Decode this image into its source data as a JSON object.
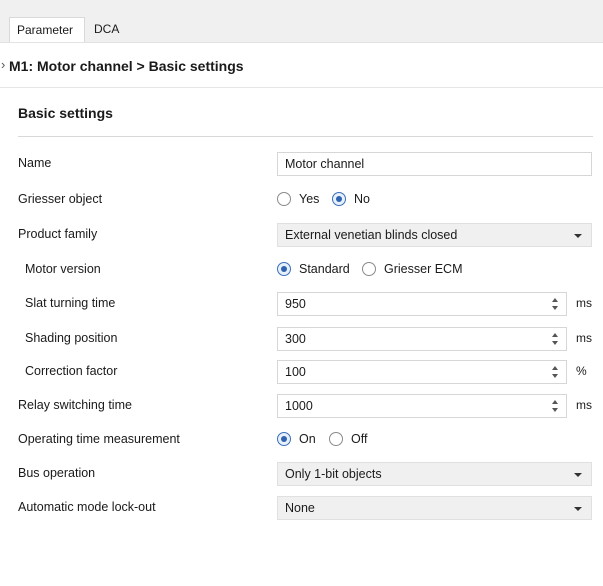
{
  "tabs": [
    {
      "label": "Parameter",
      "active": true
    },
    {
      "label": "DCA",
      "active": false
    }
  ],
  "breadcrumb": {
    "arrow": "›",
    "text": "M1: Motor channel > Basic settings"
  },
  "section": {
    "title": "Basic settings"
  },
  "fields": {
    "name": {
      "label": "Name",
      "value": "Motor channel"
    },
    "griesser_object": {
      "label": "Griesser object",
      "options": [
        "Yes",
        "No"
      ],
      "selected": "No"
    },
    "product_family": {
      "label": "Product family",
      "value": "External venetian blinds closed"
    },
    "motor_version": {
      "label": "Motor version",
      "options": [
        "Standard",
        "Griesser ECM"
      ],
      "selected": "Standard"
    },
    "slat_turning_time": {
      "label": "Slat turning time",
      "value": "950",
      "unit": "ms"
    },
    "shading_position": {
      "label": "Shading position",
      "value": "300",
      "unit": "ms"
    },
    "correction_factor": {
      "label": "Correction factor",
      "value": "100",
      "unit": "%"
    },
    "relay_switching_time": {
      "label": "Relay switching time",
      "value": "1000",
      "unit": "ms"
    },
    "operating_time_measurement": {
      "label": "Operating time measurement",
      "options": [
        "On",
        "Off"
      ],
      "selected": "On"
    },
    "bus_operation": {
      "label": "Bus operation",
      "value": "Only 1-bit objects"
    },
    "automatic_mode_lockout": {
      "label": "Automatic mode lock-out",
      "value": "None"
    }
  },
  "colors": {
    "accent": "#2f62b0",
    "tab_bar": "#f0f0f0",
    "select_bg": "#f0f0f0"
  }
}
